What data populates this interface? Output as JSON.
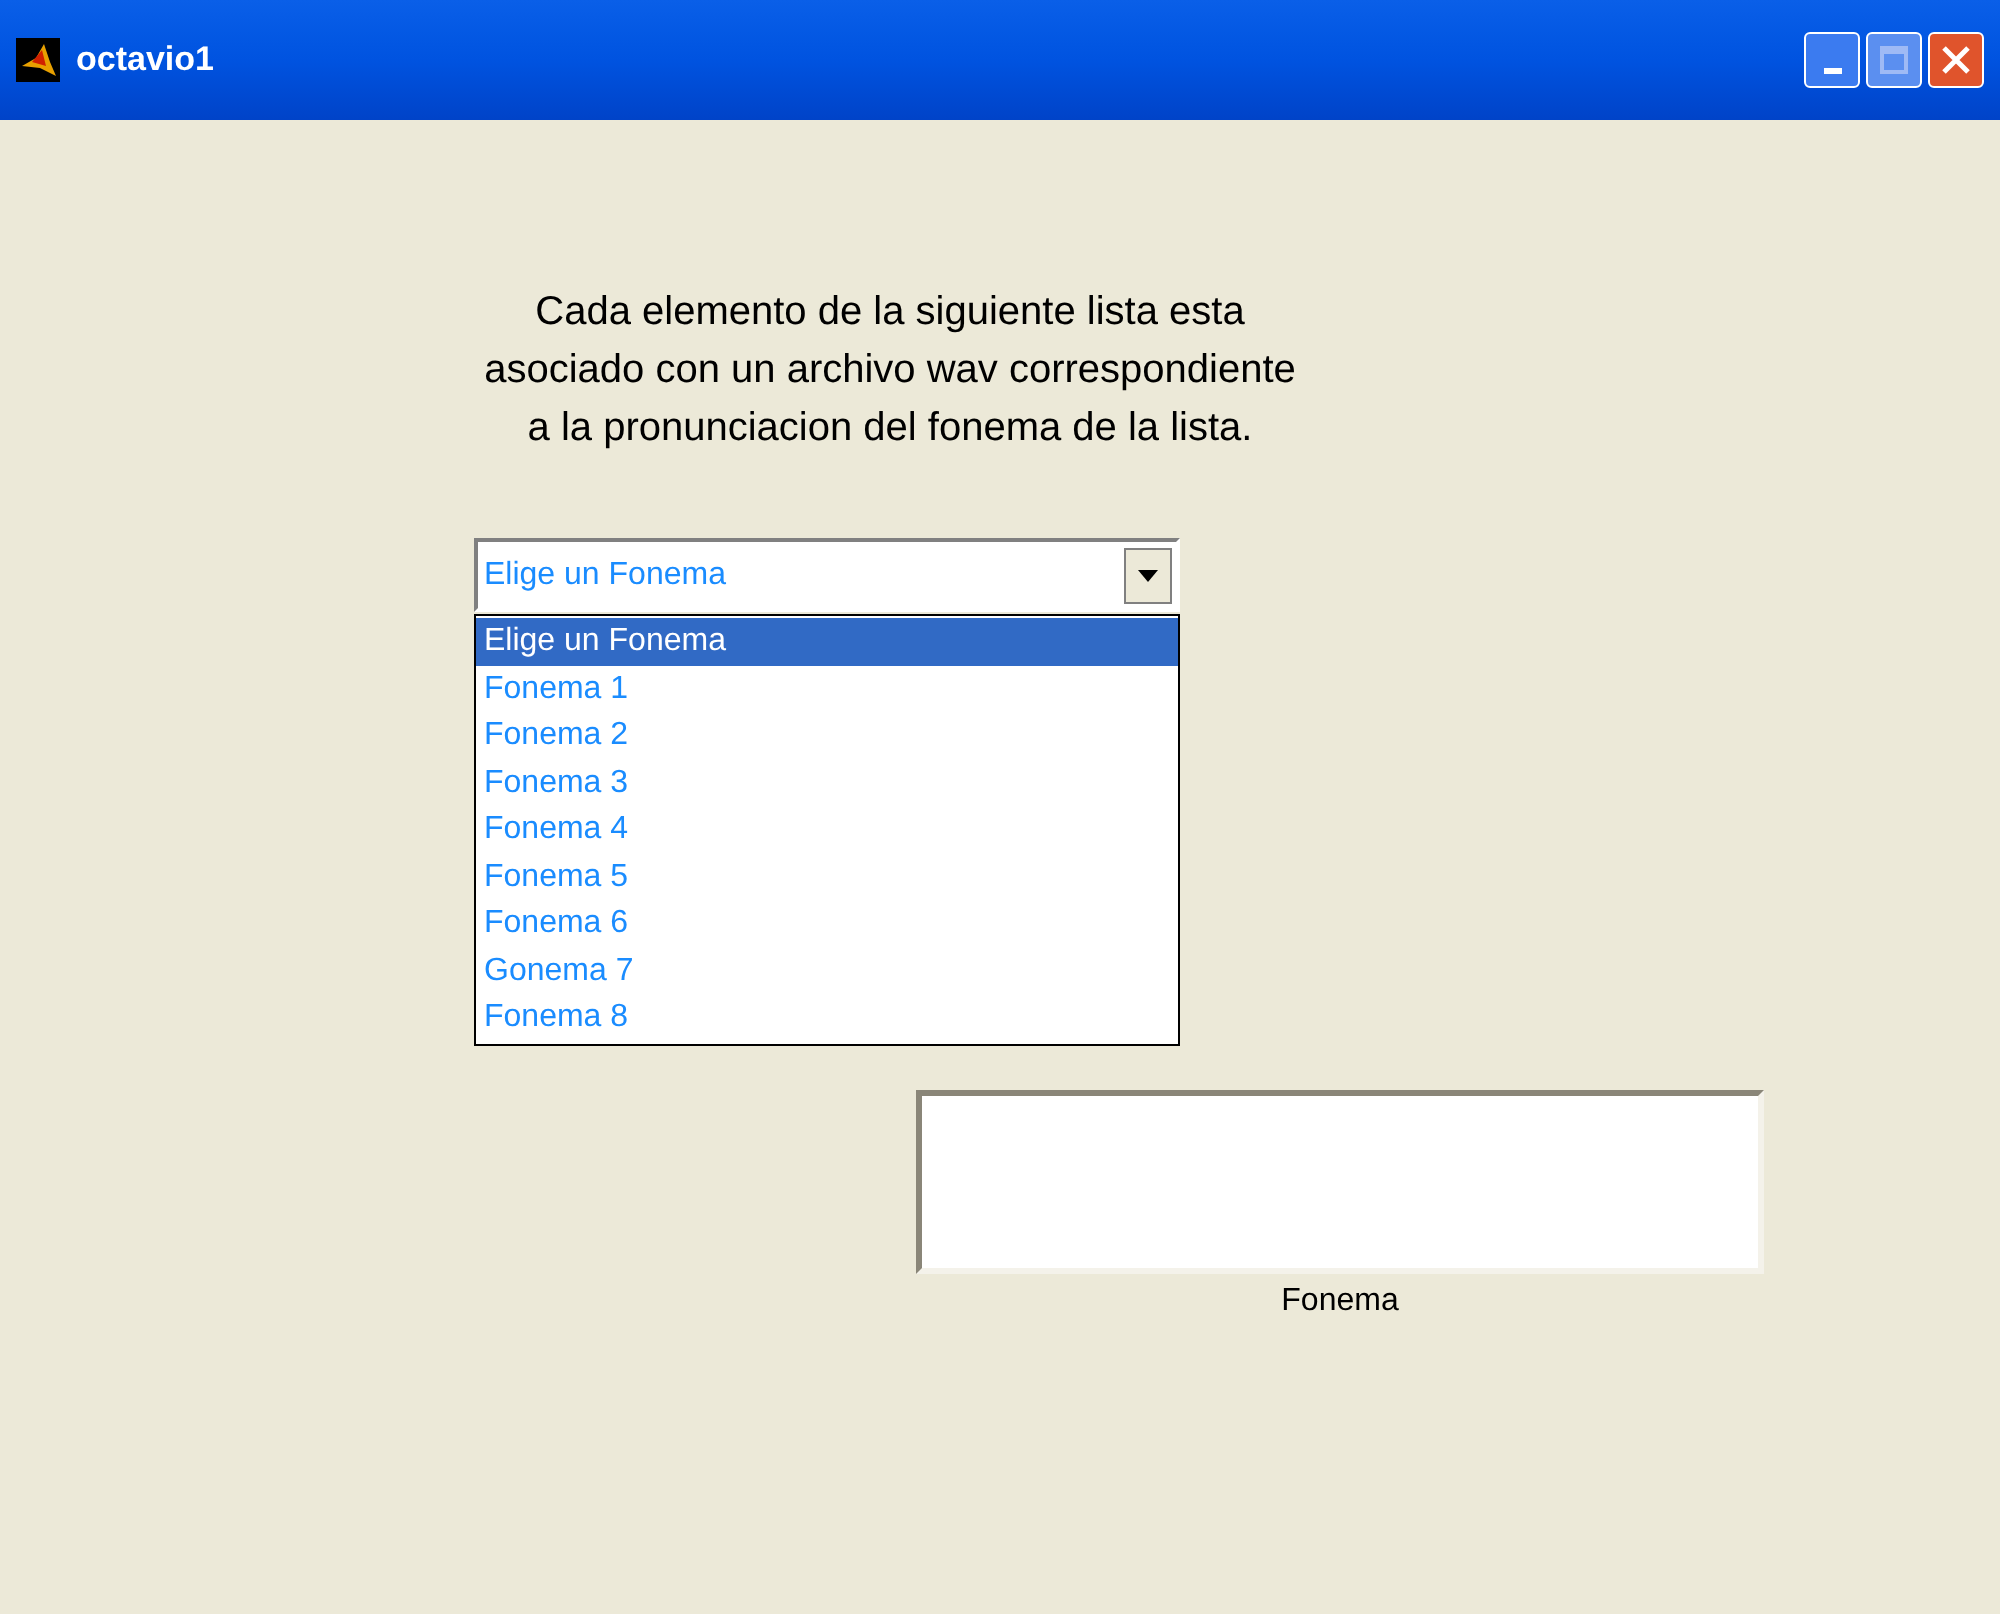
{
  "window": {
    "title": "octavio1"
  },
  "instructions": "Cada elemento de la siguiente lista esta\nasociado con un archivo wav correspondiente\na la pronunciacion del fonema de la lista.",
  "dropdown": {
    "value": "Elige un Fonema",
    "expanded": true,
    "options": [
      {
        "label": "Elige un Fonema",
        "selected": true
      },
      {
        "label": "Fonema 1",
        "selected": false
      },
      {
        "label": "Fonema 2",
        "selected": false
      },
      {
        "label": "Fonema 3",
        "selected": false
      },
      {
        "label": "Fonema 4",
        "selected": false
      },
      {
        "label": "Fonema 5",
        "selected": false
      },
      {
        "label": "Fonema 6",
        "selected": false
      },
      {
        "label": "Gonema 7",
        "selected": false
      },
      {
        "label": "Fonema 8",
        "selected": false
      }
    ]
  },
  "output_box": {
    "label": "Fonema"
  }
}
